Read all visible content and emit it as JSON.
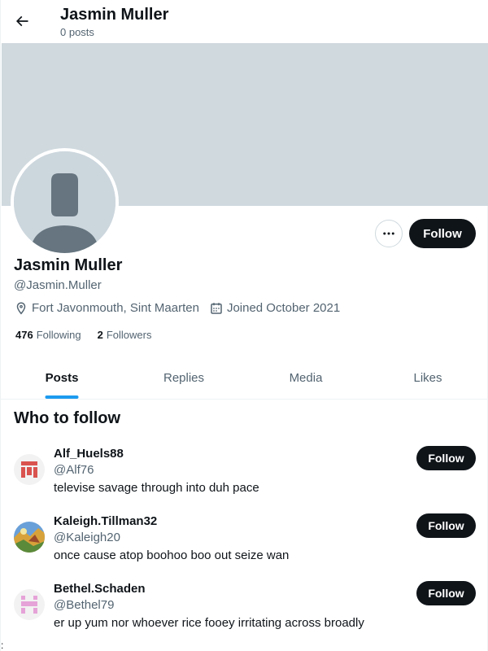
{
  "header": {
    "title": "Jasmin Muller",
    "subtitle": "0 posts"
  },
  "profile": {
    "name": "Jasmin Muller",
    "handle": "@Jasmin.Muller",
    "location": "Fort Javonmouth, Sint Maarten",
    "joined": "Joined October 2021",
    "following_count": "476",
    "following_label": "Following",
    "followers_count": "2",
    "followers_label": "Followers",
    "follow_label": "Follow"
  },
  "tabs": [
    {
      "label": "Posts",
      "active": true
    },
    {
      "label": "Replies",
      "active": false
    },
    {
      "label": "Media",
      "active": false
    },
    {
      "label": "Likes",
      "active": false
    }
  ],
  "who_to_follow": {
    "title": "Who to follow",
    "items": [
      {
        "name": "Alf_Huels88",
        "handle": "@Alf76",
        "bio": "televise savage through into duh pace",
        "follow_label": "Follow",
        "avatar_color": "#d9534f"
      },
      {
        "name": "Kaleigh.Tillman32",
        "handle": "@Kaleigh20",
        "bio": "once cause atop boohoo boo out seize wan",
        "follow_label": "Follow",
        "avatar_color": "#3b6fb6"
      },
      {
        "name": "Bethel.Schaden",
        "handle": "@Bethel79",
        "bio": "er up yum nor whoever rice fooey irritating across broadly",
        "follow_label": "Follow",
        "avatar_color": "#e6a3d8"
      }
    ]
  },
  "stray_text": ":",
  "colors": {
    "accent": "#1d9bf0",
    "banner": "#cfd9de",
    "button": "#0f1419"
  }
}
